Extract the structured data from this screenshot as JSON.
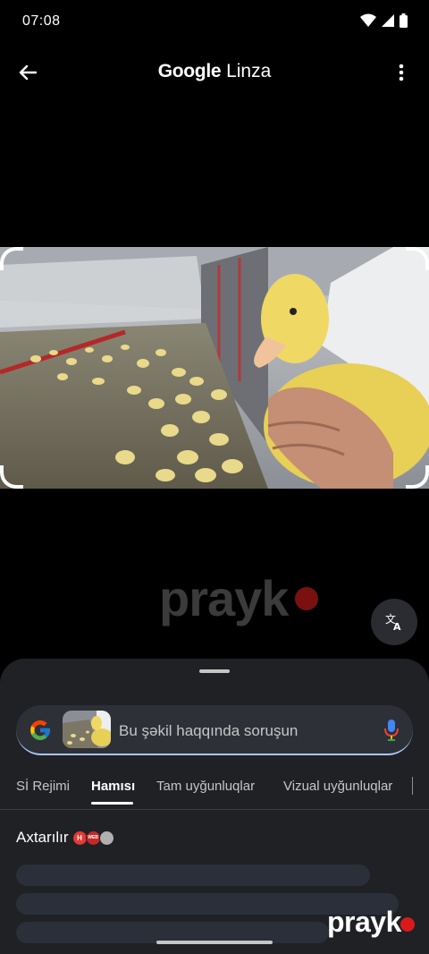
{
  "status_bar": {
    "time": "07:08",
    "icons": [
      "wifi-icon",
      "signal-icon",
      "battery-icon"
    ]
  },
  "app_bar": {
    "title_brand": "Google",
    "title_product": "Linza",
    "back_icon": "arrow-back-icon",
    "menu_icon": "more-vert-icon"
  },
  "photo": {
    "description_icon": "selected-image"
  },
  "watermark": {
    "text": "prayk"
  },
  "translate_button": {
    "icon": "translate-icon"
  },
  "search": {
    "placeholder": "Bu şəkil haqqında soruşun",
    "accent_color": "#a8c7fa"
  },
  "tabs": [
    {
      "label": "Sİ Rejimi",
      "active": false
    },
    {
      "label": "Hamısı",
      "active": true
    },
    {
      "label": "Tam uyğunluqlar",
      "active": false
    },
    {
      "label": "Vizual uyğunluqlar",
      "active": false
    }
  ],
  "results": {
    "status_text": "Axtarılır",
    "badges": [
      {
        "text": "H",
        "color": "#e53935"
      },
      {
        "text": "WEB",
        "color": "#c62828"
      },
      {
        "text": "",
        "color": "#b0b0b0"
      }
    ]
  },
  "watermark_small": {
    "text": "prayk"
  }
}
